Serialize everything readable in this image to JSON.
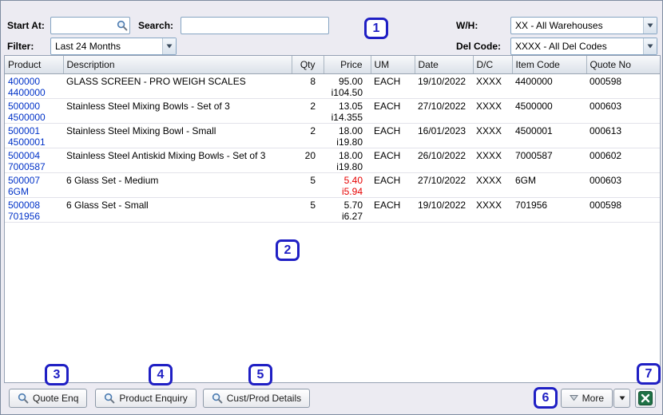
{
  "colors": {
    "link_blue": "#0032c8",
    "price_alert_red": "#e60000",
    "annotation_blue": "#1f1fc4",
    "excel_green": "#1e7145"
  },
  "header": {
    "start_at_label": "Start At:",
    "start_at_value": "",
    "search_label": "Search:",
    "search_value": "",
    "filter_label": "Filter:",
    "filter_value": "Last 24 Months",
    "wh_label": "W/H:",
    "wh_value": "XX - All Warehouses",
    "del_code_label": "Del Code:",
    "del_code_value": "XXXX - All Del Codes"
  },
  "table": {
    "columns": [
      "Product",
      "Description",
      "Qty",
      "Price",
      "UM",
      "Date",
      "D/C",
      "Item Code",
      "Quote No"
    ],
    "rows": [
      {
        "product_top": "400000",
        "product_bottom": "4400000",
        "description": "GLASS SCREEN - PRO WEIGH SCALES",
        "qty": "8",
        "price_top": "95.00",
        "price_bottom": "i104.50",
        "um": "EACH",
        "date": "19/10/2022",
        "dc": "XXXX",
        "item_code": "4400000",
        "quote_no": "000598"
      },
      {
        "product_top": "500000",
        "product_bottom": "4500000",
        "description": "Stainless Steel Mixing Bowls - Set of 3",
        "qty": "2",
        "price_top": "13.05",
        "price_bottom": "i14.355",
        "um": "EACH",
        "date": "27/10/2022",
        "dc": "XXXX",
        "item_code": "4500000",
        "quote_no": "000603"
      },
      {
        "product_top": "500001",
        "product_bottom": "4500001",
        "description": "Stainless Steel Mixing Bowl - Small",
        "qty": "2",
        "price_top": "18.00",
        "price_bottom": "i19.80",
        "um": "EACH",
        "date": "16/01/2023",
        "dc": "XXXX",
        "item_code": "4500001",
        "quote_no": "000613"
      },
      {
        "product_top": "500004",
        "product_bottom": "7000587",
        "description": "Stainless Steel Antiskid Mixing Bowls - Set of 3",
        "qty": "20",
        "price_top": "18.00",
        "price_bottom": "i19.80",
        "um": "EACH",
        "date": "26/10/2022",
        "dc": "XXXX",
        "item_code": "7000587",
        "quote_no": "000602"
      },
      {
        "product_top": "500007",
        "product_bottom": "6GM",
        "description": "6 Glass Set - Medium",
        "qty": "5",
        "price_top": "5.40",
        "price_bottom": "i5.94",
        "um": "EACH",
        "date": "27/10/2022",
        "dc": "XXXX",
        "item_code": "6GM",
        "quote_no": "000603"
      },
      {
        "product_top": "500008",
        "product_bottom": "701956",
        "description": "6 Glass Set - Small",
        "qty": "5",
        "price_top": "5.70",
        "price_bottom": "i6.27",
        "um": "EACH",
        "date": "19/10/2022",
        "dc": "XXXX",
        "item_code": "701956",
        "quote_no": "000598"
      }
    ]
  },
  "footer": {
    "quote_enq_label": "Quote Enq",
    "product_enquiry_label": "Product Enquiry",
    "cust_prod_details_label": "Cust/Prod Details",
    "more_label": "More"
  },
  "annotations": [
    "1",
    "2",
    "3",
    "4",
    "5",
    "6",
    "7"
  ]
}
